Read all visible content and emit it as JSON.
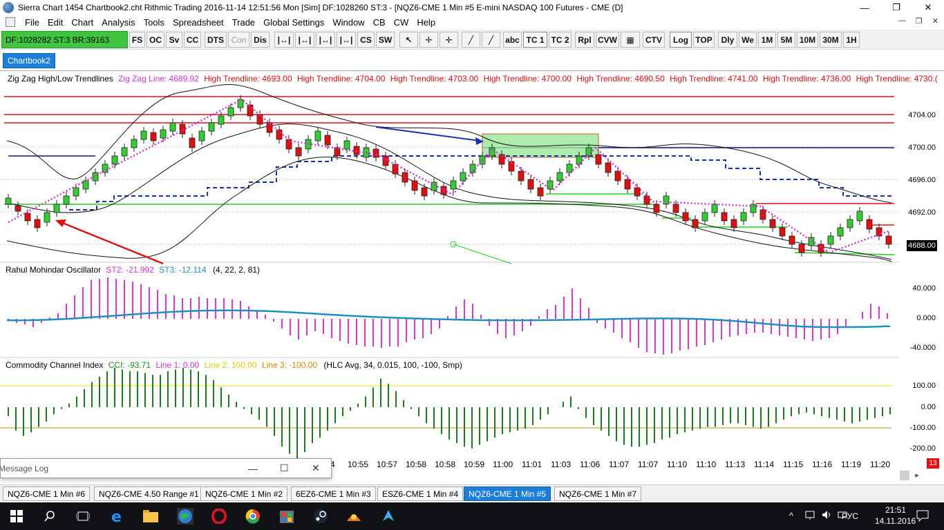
{
  "window": {
    "title": "Sierra Chart 1454 Chartbook2.cht  Rithmic Trading 2016-11-14  12:51:56 Mon [Sim]  DF:1028260  ST:3 - [NQZ6-CME  1 Min  #5  E-mini NASDAQ 100 Futures - CME (D]",
    "min": "—",
    "max": "❐",
    "close": "✕"
  },
  "menu": [
    "File",
    "Edit",
    "Chart",
    "Analysis",
    "Tools",
    "Spreadsheet",
    "Trade",
    "Global Settings",
    "Window",
    "CB",
    "CW",
    "Help"
  ],
  "mdi": {
    "min": "—",
    "restore": "❐",
    "close": "✕"
  },
  "status_box": "DF:1028282  ST:3  BR:39163",
  "toolbar": [
    "FS",
    "OC",
    "Sv",
    "CC",
    "DTS",
    "Con",
    "Dis",
    "|↔|",
    "|↔|",
    "|↔|",
    "|↔|",
    "CS",
    "SW",
    "↖",
    "✛",
    "✛",
    "╱",
    "╱",
    "abc",
    "TC 1",
    "TC 2",
    "Rpl",
    "CVW",
    "▦",
    "CTV",
    "Log",
    "TOP",
    "Dly",
    "We",
    "1M",
    "5M",
    "10M",
    "30M",
    "1H"
  ],
  "chartbook_tab": "Chartbook2",
  "region1": {
    "label": "Zig Zag High/Low Trendlines",
    "zigzag": "Zig Zag Line: 4689.92",
    "trendlines": [
      "High Trendline: 4693.00",
      "High Trendline: 4704.00",
      "High Trendline: 4703.00",
      "High Trendline: 4700.00",
      "High Trendline: 4690.50",
      "High Trendline: 4741.00",
      "High Trendline: 4736.00",
      "High Trendline: 4730.("
    ],
    "price_labels": [
      "4704.00",
      "4700.00",
      "4696.00",
      "4692.00"
    ],
    "last_price": "4688.00"
  },
  "region2": {
    "label": "Rahul Mohindar Oscillator",
    "st2": "ST2: -21.992",
    "st3": "ST3: -12.114",
    "params": "(4, 22, 2, 81)",
    "scale": [
      "40.000",
      "0.000",
      "-40.000"
    ]
  },
  "region3": {
    "label": "Commodity Channel Index",
    "cci": "CCI: -93.71",
    "line1": "Line 1: 0.00",
    "line2": "Line 2: 100.00",
    "line3": "Line 3: -100.00",
    "params": "(HLC Avg, 34, 0.015, 100, -100, Smp)",
    "scale": [
      "100.00",
      "0.00",
      "-100.00",
      "-200.00"
    ]
  },
  "time_axis": [
    "4",
    "10:55",
    "10:57",
    "10:58",
    "10:58",
    "10:59",
    "11:00",
    "11:01",
    "11:03",
    "11:06",
    "11:07",
    "11:07",
    "11:10",
    "11:10",
    "11:13",
    "11:14",
    "11:15",
    "11:16",
    "11:19",
    "11:20"
  ],
  "corner_badge": "13",
  "message_log": {
    "title": "Message Log",
    "min": "—",
    "max": "☐",
    "close": "✕"
  },
  "bottom_tabs": [
    "NQZ6-CME  1 Min  #6",
    "NQZ6-CME  4.50 Range  #1",
    "NQZ6-CME  1 Min  #2",
    "6EZ6-CME  1 Min  #3",
    "ESZ6-CME  1 Min  #4",
    "NQZ6-CME  1 Min  #5",
    "NQZ6-CME  1 Min  #7"
  ],
  "taskbar": {
    "lang": "РУС",
    "time": "21:51",
    "date": "14.11.2016"
  },
  "colors": {
    "up": "#33cc33",
    "down": "#dd1111",
    "zigzag": "#cc33cc",
    "cci": "#1b7a1b",
    "rmo_hist": "#d633d6",
    "rmo_line": "#1f8fbf"
  }
}
